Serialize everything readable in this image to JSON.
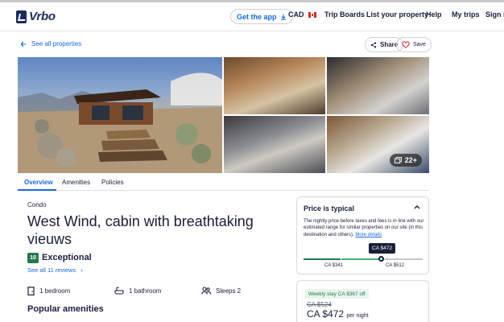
{
  "brand": {
    "logo_text": "Vrbo"
  },
  "header": {
    "get_app": "Get the app",
    "currency": "CAD",
    "trip_boards": "Trip Boards",
    "list_property": "List your property",
    "help": "Help",
    "my_trips": "My trips",
    "sign_in": "Sign in"
  },
  "actions": {
    "back": "See all properties",
    "share": "Share",
    "save": "Save"
  },
  "gallery": {
    "more_count": "22+"
  },
  "tabs": [
    "Overview",
    "Amenities",
    "Policies"
  ],
  "property": {
    "type": "Condo",
    "title": "West Wind, cabin with breathtaking vieuws",
    "rating_score": "10",
    "rating_label": "Exceptional",
    "reviews_link": "See all 11 reviews",
    "bedrooms": "1 bedroom",
    "bathrooms": "1 bathroom",
    "sleeps": "Sleeps 2",
    "amenities_heading": "Popular amenities"
  },
  "price_card": {
    "title": "Price is typical",
    "description": "The nightly price before taxes and fees is in line with our estimated range for similar properties on our site (in this destination and others).",
    "more_details": "More details",
    "current_label": "CA $472",
    "current_value": 472,
    "range_low": "CA $341",
    "range_high": "CA $512",
    "colors": {
      "low": "#227950",
      "typical": "#3fb66f",
      "high": "#c4c6cc"
    }
  },
  "stay": {
    "badge": "Weekly stay CA $367 off",
    "old_price": "CA $524",
    "new_price": "CA $472",
    "per": "per night"
  },
  "colors": {
    "accent": "#1668e3",
    "brand": "#1b2b5e",
    "rating": "#227950",
    "text": "#191e3b"
  }
}
